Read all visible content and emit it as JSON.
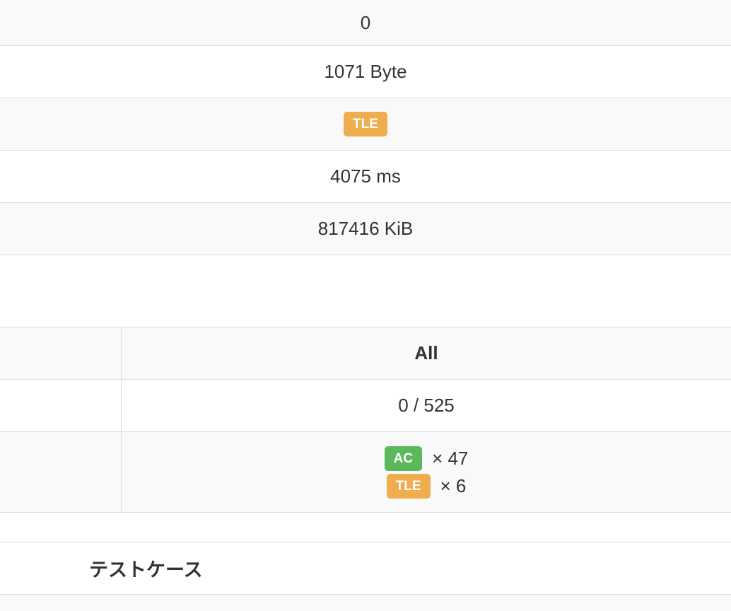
{
  "detail": {
    "row1": "0",
    "code_size": "1071 Byte",
    "status": "TLE",
    "exec_time": "4075 ms",
    "memory": "817416 KiB"
  },
  "summary": {
    "column_header": "All",
    "score": "0 / 525",
    "results": [
      {
        "status": "AC",
        "count": "× 47",
        "color": "#5cb85c"
      },
      {
        "status": "TLE",
        "count": "× 6",
        "color": "#f0ad4e"
      }
    ]
  },
  "testcases": {
    "title": "テストケース"
  }
}
